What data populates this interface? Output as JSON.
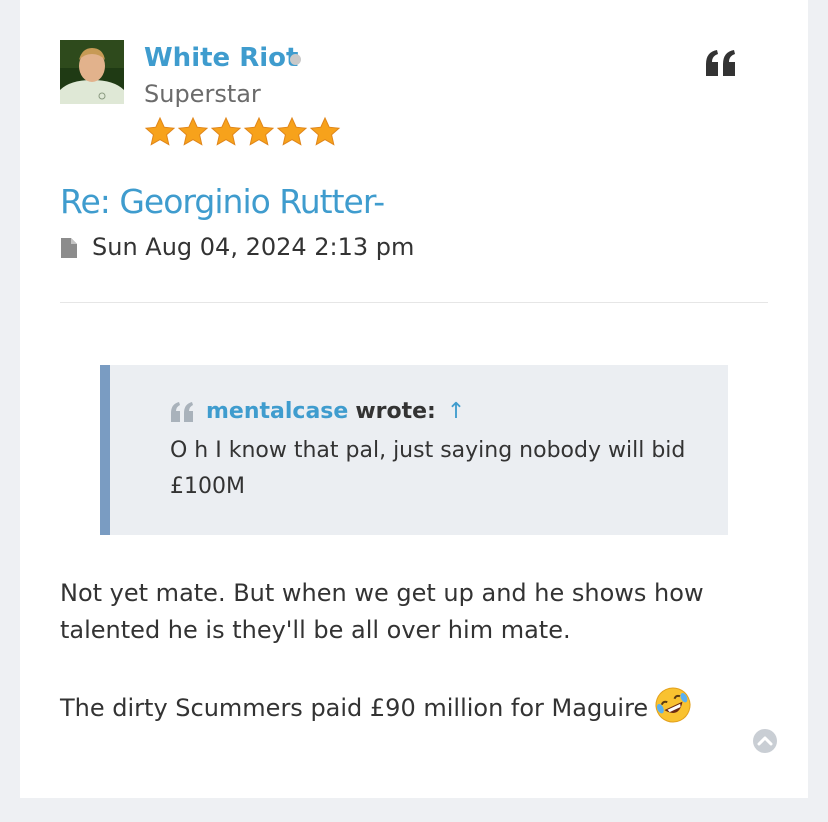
{
  "author": {
    "username": "White Riot",
    "status": "offline",
    "rank": "Superstar",
    "rank_stars": 6,
    "username_color": "#3f9cce"
  },
  "post": {
    "title": "Re: Georginio Rutter-",
    "date": "Sun Aug 04, 2024 2:13 pm",
    "quote_button_icon": "quote-icon",
    "post_icon": "file-icon"
  },
  "blockquote": {
    "cite_user": "mentalcase",
    "cite_wrote": "wrote:",
    "cite_arrow": "↑",
    "text": "O h I know that pal, just saying nobody will bid £100M"
  },
  "body": {
    "paragraph1": "Not yet mate. But when we get up and he shows how talented he is they'll be all over him mate.",
    "paragraph2": "The dirty Scummers paid £90 million for Maguire",
    "emoji": "rolling-on-floor-laughing"
  },
  "colors": {
    "link": "#3f9cce",
    "quote_border": "#7a9cc2",
    "quote_bg": "#ebeef2",
    "star": "#f7a21b"
  }
}
